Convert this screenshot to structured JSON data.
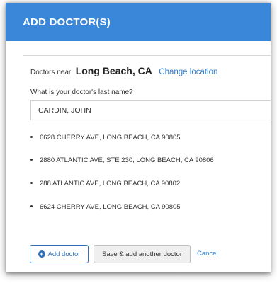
{
  "dialog": {
    "title": "ADD DOCTOR(S)",
    "near_label": "Doctors near",
    "location": "Long Beach, CA",
    "change_location": "Change location",
    "question": "What is your doctor's last name?",
    "name_value": "CARDIN, JOHN",
    "header_color": "#3a86d8",
    "link_color": "#2f7fd0"
  },
  "results": [
    {
      "address": "6628 CHERRY AVE, LONG BEACH, CA 90805"
    },
    {
      "address": "2880 ATLANTIC AVE, STE 230, LONG BEACH, CA 90806"
    },
    {
      "address": "288 ATLANTIC AVE, LONG BEACH, CA 90802"
    },
    {
      "address": "6624 CHERRY AVE, LONG BEACH, CA 90805"
    }
  ],
  "actions": {
    "add_doctor": "Add doctor",
    "add_icon": "plus-circle-icon",
    "save_add_another": "Save & add another doctor",
    "cancel": "Cancel"
  }
}
